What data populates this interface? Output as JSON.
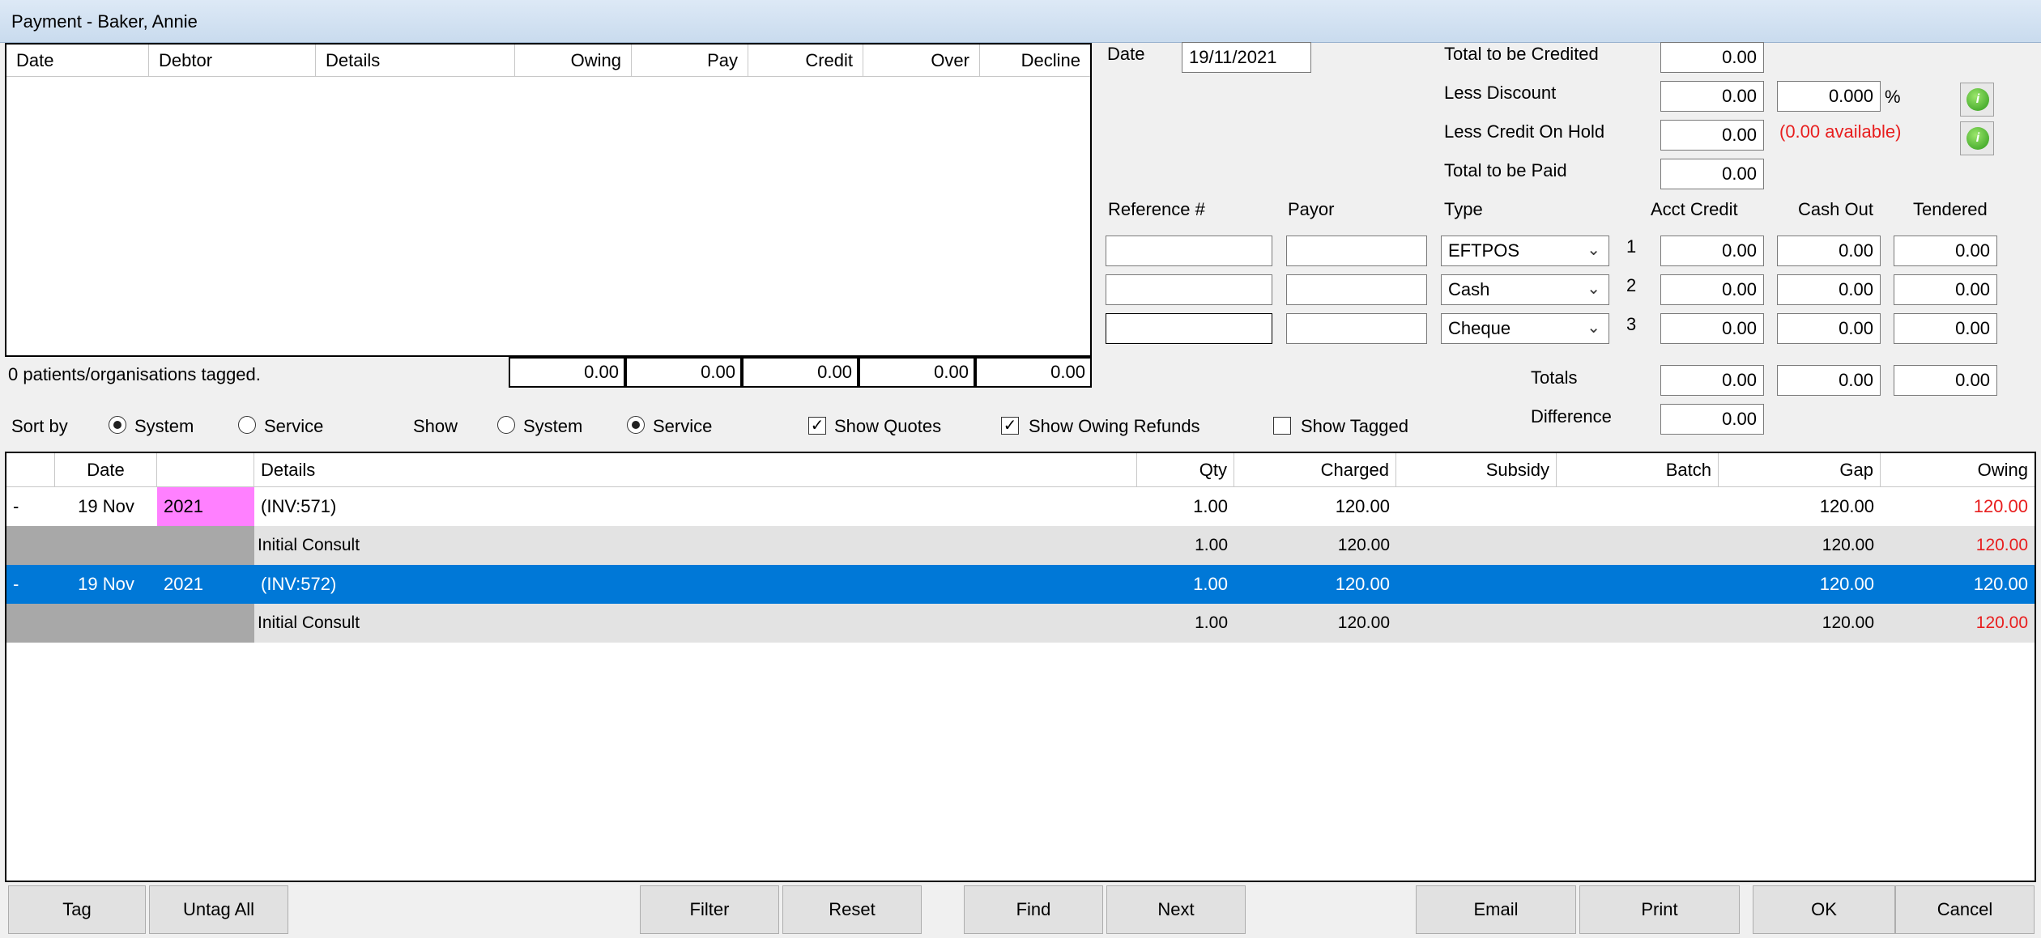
{
  "window": {
    "title": "Payment - Baker, Annie"
  },
  "debtor_grid": {
    "columns": [
      "Date",
      "Debtor",
      "Details",
      "Owing",
      "Pay",
      "Credit",
      "Over",
      "Decline"
    ],
    "tagged_text": "0 patients/organisations tagged.",
    "totals": [
      "0.00",
      "0.00",
      "0.00",
      "0.00",
      "0.00"
    ]
  },
  "payment": {
    "date_label": "Date",
    "date_value": "19/11/2021",
    "total_credited_label": "Total to be Credited",
    "total_credited_value": "0.00",
    "less_discount_label": "Less Discount",
    "less_discount_value": "0.00",
    "discount_pct_value": "0.000",
    "pct_symbol": "%",
    "less_credit_hold_label": "Less Credit On Hold",
    "less_credit_hold_value": "0.00",
    "credit_available": "(0.00 available)",
    "total_paid_label": "Total to be Paid",
    "total_paid_value": "0.00",
    "columns": {
      "reference": "Reference #",
      "payor": "Payor",
      "type": "Type",
      "acct_credit": "Acct Credit",
      "cash_out": "Cash Out",
      "tendered": "Tendered"
    },
    "lines": [
      {
        "num": "1",
        "reference": "",
        "payor": "",
        "type": "EFTPOS",
        "acct_credit": "0.00",
        "cash_out": "0.00",
        "tendered": "0.00"
      },
      {
        "num": "2",
        "reference": "",
        "payor": "",
        "type": "Cash",
        "acct_credit": "0.00",
        "cash_out": "0.00",
        "tendered": "0.00"
      },
      {
        "num": "3",
        "reference": "",
        "payor": "",
        "type": "Cheque",
        "acct_credit": "0.00",
        "cash_out": "0.00",
        "tendered": "0.00"
      }
    ],
    "totals_label": "Totals",
    "totals": {
      "acct_credit": "0.00",
      "cash_out": "0.00",
      "tendered": "0.00"
    },
    "difference_label": "Difference",
    "difference_value": "0.00"
  },
  "options": {
    "sort_by_label": "Sort by",
    "sort_system": "System",
    "sort_service": "Service",
    "sort_selected": "System",
    "show_label": "Show",
    "show_system": "System",
    "show_service": "Service",
    "show_selected": "Service",
    "show_quotes": {
      "label": "Show Quotes",
      "checked": true
    },
    "show_owing_refunds": {
      "label": "Show Owing Refunds",
      "checked": true
    },
    "show_tagged": {
      "label": "Show Tagged",
      "checked": false
    }
  },
  "items_grid": {
    "columns": {
      "date": "Date",
      "details": "Details",
      "qty": "Qty",
      "charged": "Charged",
      "subsidy": "Subsidy",
      "batch": "Batch",
      "gap": "Gap",
      "owing": "Owing"
    },
    "rows": [
      {
        "marker": "-",
        "date": "19 Nov",
        "year": "2021",
        "details": "(INV:571)",
        "qty": "1.00",
        "charged": "120.00",
        "subsidy": "",
        "batch": "",
        "gap": "120.00",
        "owing": "120.00"
      },
      {
        "marker": "",
        "date": "",
        "year": "",
        "details": "Initial Consult",
        "qty": "1.00",
        "charged": "120.00",
        "subsidy": "",
        "batch": "",
        "gap": "120.00",
        "owing": "120.00"
      },
      {
        "marker": "-",
        "date": "19 Nov",
        "year": "2021",
        "details": "(INV:572)",
        "qty": "1.00",
        "charged": "120.00",
        "subsidy": "",
        "batch": "",
        "gap": "120.00",
        "owing": "120.00"
      },
      {
        "marker": "",
        "date": "",
        "year": "",
        "details": "Initial Consult",
        "qty": "1.00",
        "charged": "120.00",
        "subsidy": "",
        "batch": "",
        "gap": "120.00",
        "owing": "120.00"
      }
    ]
  },
  "buttons": {
    "tag": "Tag",
    "untag_all": "Untag All",
    "filter": "Filter",
    "reset": "Reset",
    "find": "Find",
    "next": "Next",
    "email": "Email",
    "print": "Print",
    "ok": "OK",
    "cancel": "Cancel"
  },
  "colors": {
    "selection": "#0078d7",
    "highlight_year": "#ff80ff",
    "group_gray": "#a8a8a8",
    "sub_row": "#e3e3e3",
    "owing_red": "#e81e1e"
  }
}
